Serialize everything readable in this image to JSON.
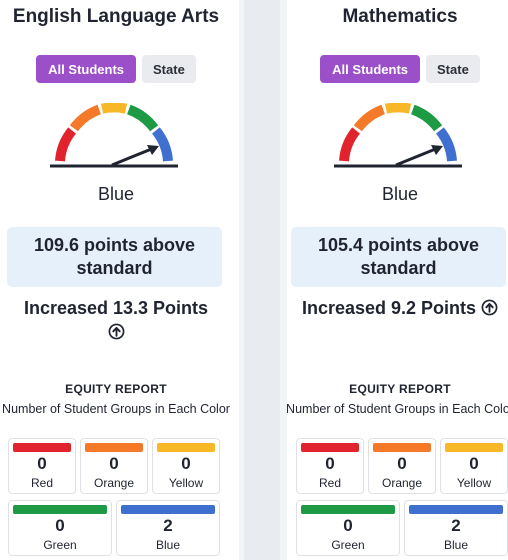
{
  "panels": [
    {
      "title": "English Language Arts",
      "toggle": {
        "active": "All Students",
        "inactive": "State"
      },
      "status": "Blue",
      "points_text": "109.6 points above standard",
      "change_text": "Increased 13.3 Points",
      "equity": {
        "title": "EQUITY REPORT",
        "subtitle": "Number of Student Groups in Each Color",
        "cells": [
          {
            "label": "Red",
            "value": "0",
            "color": "#e0232d"
          },
          {
            "label": "Orange",
            "value": "0",
            "color": "#f47a2a"
          },
          {
            "label": "Yellow",
            "value": "0",
            "color": "#f7b726"
          },
          {
            "label": "Green",
            "value": "0",
            "color": "#1e9a45"
          },
          {
            "label": "Blue",
            "value": "2",
            "color": "#3f6fcf"
          }
        ]
      }
    },
    {
      "title": "Mathematics",
      "toggle": {
        "active": "All Students",
        "inactive": "State"
      },
      "status": "Blue",
      "points_text": "105.4 points above standard",
      "change_text": "Increased 9.2 Points",
      "equity": {
        "title": "EQUITY REPORT",
        "subtitle": "Number of Student Groups in Each Color",
        "cells": [
          {
            "label": "Red",
            "value": "0",
            "color": "#e0232d"
          },
          {
            "label": "Orange",
            "value": "0",
            "color": "#f47a2a"
          },
          {
            "label": "Yellow",
            "value": "0",
            "color": "#f7b726"
          },
          {
            "label": "Green",
            "value": "0",
            "color": "#1e9a45"
          },
          {
            "label": "Blue",
            "value": "2",
            "color": "#3f6fcf"
          }
        ]
      }
    }
  ],
  "gauge_colors": [
    "#e0232d",
    "#f47a2a",
    "#f7b726",
    "#1e9a45",
    "#3f6fcf"
  ],
  "icons": {
    "gauge": "gauge-icon",
    "change": "arrow-up-circle-icon"
  }
}
